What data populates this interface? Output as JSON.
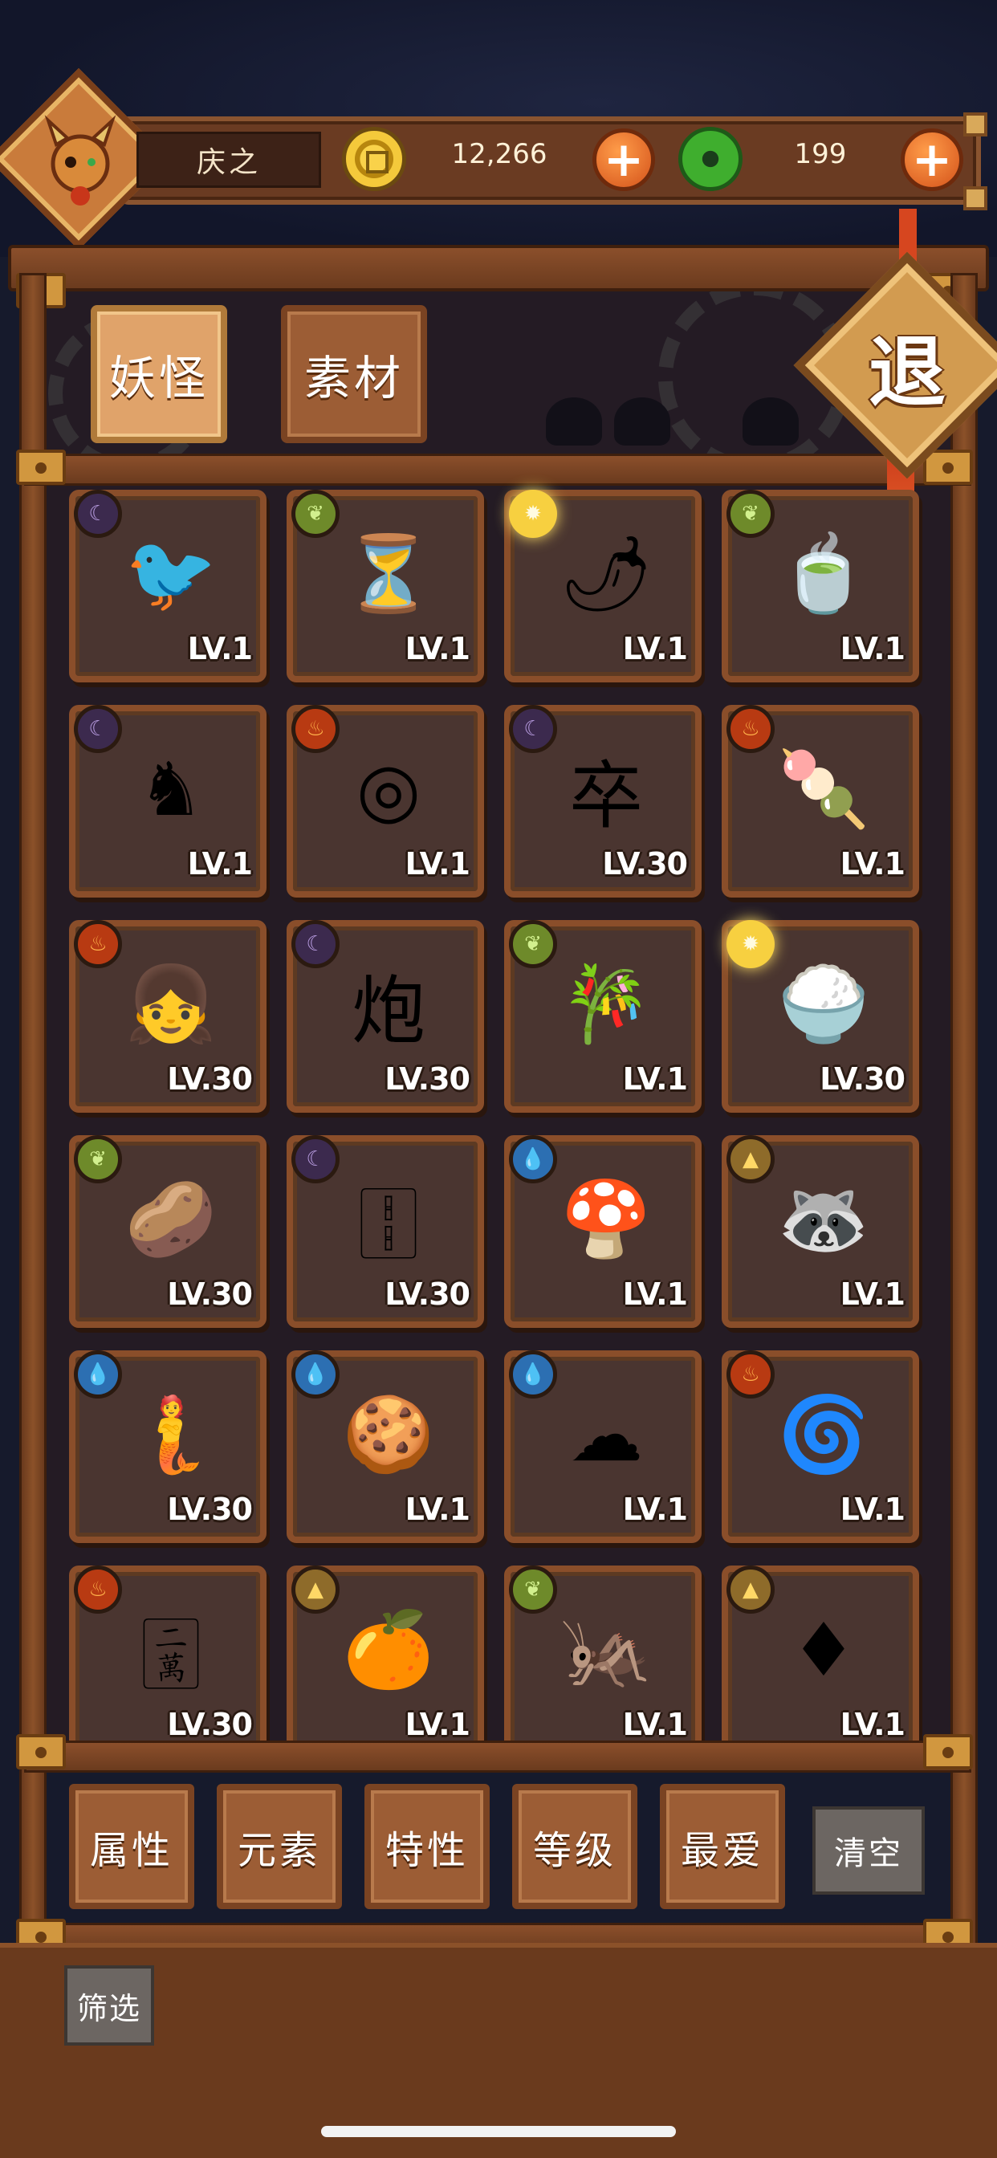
{
  "player": {
    "name": "庆之"
  },
  "resources": {
    "gold": "12,266",
    "jade": "199",
    "gold_plus": "+",
    "jade_plus": "+"
  },
  "tabs": {
    "monsters": "妖怪",
    "materials": "素材"
  },
  "exit_label": "退",
  "monsters": [
    {
      "element": "dark",
      "element_icon": "moon-icon",
      "sprite": "bird-kite-monster",
      "glyph": "🐦",
      "level": "LV.1"
    },
    {
      "element": "wood",
      "element_icon": "leaf-icon",
      "sprite": "hourglass-monster",
      "glyph": "⏳",
      "level": "LV.1"
    },
    {
      "element": "light",
      "element_icon": "sun-icon",
      "sprite": "radish-monster",
      "glyph": "🌶",
      "level": "LV.1"
    },
    {
      "element": "wood",
      "element_icon": "leaf-icon",
      "sprite": "porcelain-cup-monster",
      "glyph": "🍵",
      "level": "LV.1"
    },
    {
      "element": "dark",
      "element_icon": "moon-icon",
      "sprite": "chess-horse-monster",
      "glyph": "♞",
      "level": "LV.1"
    },
    {
      "element": "fire",
      "element_icon": "flame-icon",
      "sprite": "jade-ring-monster",
      "glyph": "◎",
      "level": "LV.1"
    },
    {
      "element": "dark",
      "element_icon": "moon-icon",
      "sprite": "chess-soldier-monster",
      "glyph": "卒",
      "level": "LV.30"
    },
    {
      "element": "fire",
      "element_icon": "flame-icon",
      "sprite": "mochi-monster",
      "glyph": "🍡",
      "level": "LV.1"
    },
    {
      "element": "fire",
      "element_icon": "flame-icon",
      "sprite": "red-hood-girl-monster",
      "glyph": "👧",
      "level": "LV.30"
    },
    {
      "element": "dark",
      "element_icon": "moon-icon",
      "sprite": "chess-cannon-monster",
      "glyph": "炮",
      "level": "LV.30"
    },
    {
      "element": "wood",
      "element_icon": "leaf-icon",
      "sprite": "bamboo-sprout-monster",
      "glyph": "🎋",
      "level": "LV.1"
    },
    {
      "element": "light",
      "element_icon": "sun-icon",
      "sprite": "rice-bowl-monster",
      "glyph": "🍚",
      "level": "LV.30"
    },
    {
      "element": "wood",
      "element_icon": "leaf-icon",
      "sprite": "potato-star-monster",
      "glyph": "🥔",
      "level": "LV.30"
    },
    {
      "element": "dark",
      "element_icon": "moon-icon",
      "sprite": "mahjong-tile-monster",
      "glyph": "🀑",
      "level": "LV.30"
    },
    {
      "element": "water",
      "element_icon": "drop-icon",
      "sprite": "blue-mushroom-monster",
      "glyph": "🍄",
      "level": "LV.1"
    },
    {
      "element": "earth",
      "element_icon": "mountain-icon",
      "sprite": "straw-hat-raccoon-monster",
      "glyph": "🦝",
      "level": "LV.1"
    },
    {
      "element": "water",
      "element_icon": "drop-icon",
      "sprite": "water-maiden-monster",
      "glyph": "🧜",
      "level": "LV.30"
    },
    {
      "element": "water",
      "element_icon": "drop-icon",
      "sprite": "cookie-bird-monster",
      "glyph": "🍪",
      "level": "LV.1"
    },
    {
      "element": "water",
      "element_icon": "drop-icon",
      "sprite": "cloud-slime-monster",
      "glyph": "☁",
      "level": "LV.1"
    },
    {
      "element": "fire",
      "element_icon": "flame-icon",
      "sprite": "fire-roll-monster",
      "glyph": "🌀",
      "level": "LV.1"
    },
    {
      "element": "fire",
      "element_icon": "flame-icon",
      "sprite": "mahjong-wan-monster",
      "glyph": "🀈",
      "level": "LV.30"
    },
    {
      "element": "earth",
      "element_icon": "mountain-icon",
      "sprite": "orange-monster",
      "glyph": "🍊",
      "level": "LV.1"
    },
    {
      "element": "wood",
      "element_icon": "leaf-icon",
      "sprite": "cricket-monster",
      "glyph": "🦗",
      "level": "LV.1"
    },
    {
      "element": "earth",
      "element_icon": "mountain-icon",
      "sprite": "diamond-charm-monster",
      "glyph": "♦",
      "level": "LV.1"
    }
  ],
  "filters": [
    "属性",
    "元素",
    "特性",
    "等级",
    "最爱"
  ],
  "clear_label": "清空",
  "screen_label": "筛选",
  "colors": {
    "wood_frame": "#8a4e2a",
    "card_bg": "#4a3530",
    "tab_active": "#e0a36a",
    "plus_orange": "#d4521a"
  }
}
